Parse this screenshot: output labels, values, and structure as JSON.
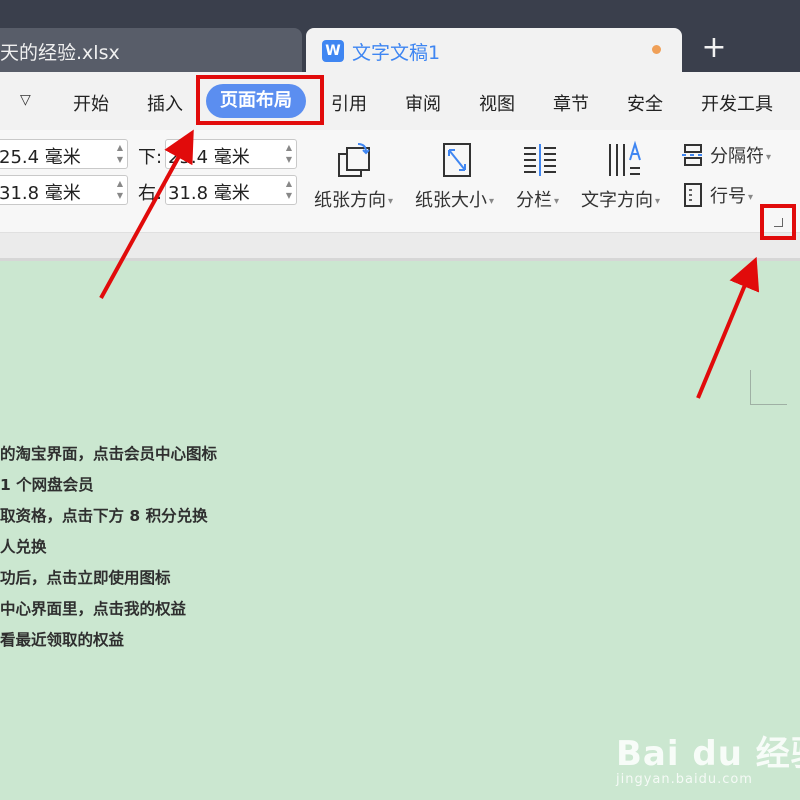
{
  "tabs": {
    "xlsx_title": "天的经验.xlsx",
    "doc_title": "文字文稿1",
    "new_tab": "+"
  },
  "menu": {
    "more": "▽",
    "items": [
      "开始",
      "插入",
      "页面布局",
      "引用",
      "审阅",
      "视图",
      "章节",
      "安全",
      "开发工具"
    ],
    "active": "页面布局"
  },
  "ribbon": {
    "margin_top": "25.4 毫米",
    "margin_left": "31.8 毫米",
    "bottom_label": "下:",
    "margin_bottom": "25.4 毫米",
    "right_label": "右:",
    "margin_right": "31.8 毫米",
    "orientation": "纸张方向",
    "size": "纸张大小",
    "columns": "分栏",
    "text_direction": "文字方向",
    "separator": "分隔符",
    "line_number": "行号"
  },
  "document": {
    "lines": [
      "的淘宝界面，点击会员中心图标",
      "1 个网盘会员",
      "取资格，点击下方 8 积分兑换",
      "人兑换",
      "功后，点击立即使用图标",
      "中心界面里，点击我的权益",
      "看最近领取的权益"
    ]
  },
  "watermark": {
    "brand": "Bai du 经验",
    "url": "jingyan.baidu.com"
  },
  "colors": {
    "accent": "#5b8ef0",
    "annotation_red": "#e10b0b",
    "doc_background": "#cbe7d0",
    "tabbar": "#3a3f4c"
  }
}
